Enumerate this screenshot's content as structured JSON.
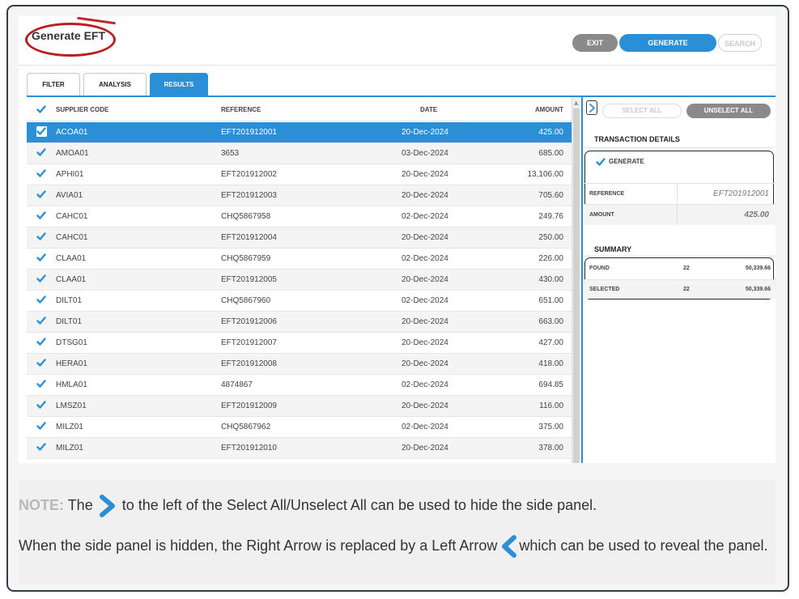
{
  "header": {
    "title": "Generate EFT",
    "exit_label": "EXIT",
    "generate_label": "GENERATE",
    "search_label": "SEARCH"
  },
  "tabs": [
    {
      "label": "FILTER"
    },
    {
      "label": "ANALYSIS"
    },
    {
      "label": "RESULTS"
    }
  ],
  "table": {
    "columns": {
      "code": "SUPPLIER CODE",
      "reference": "REFERENCE",
      "date": "DATE",
      "amount": "AMOUNT"
    },
    "rows": [
      {
        "code": "ACOA01",
        "reference": "EFT201912001",
        "date": "20-Dec-2024",
        "amount": "425.00"
      },
      {
        "code": "AMOA01",
        "reference": "3653",
        "date": "03-Dec-2024",
        "amount": "685.00"
      },
      {
        "code": "APHI01",
        "reference": "EFT201912002",
        "date": "20-Dec-2024",
        "amount": "13,106.00"
      },
      {
        "code": "AVIA01",
        "reference": "EFT201912003",
        "date": "20-Dec-2024",
        "amount": "705.60"
      },
      {
        "code": "CAHC01",
        "reference": "CHQ5867958",
        "date": "02-Dec-2024",
        "amount": "249.76"
      },
      {
        "code": "CAHC01",
        "reference": "EFT201912004",
        "date": "20-Dec-2024",
        "amount": "250.00"
      },
      {
        "code": "CLAA01",
        "reference": "CHQ5867959",
        "date": "02-Dec-2024",
        "amount": "226.00"
      },
      {
        "code": "CLAA01",
        "reference": "EFT201912005",
        "date": "20-Dec-2024",
        "amount": "430.00"
      },
      {
        "code": "DILT01",
        "reference": "CHQ5867960",
        "date": "02-Dec-2024",
        "amount": "651.00"
      },
      {
        "code": "DILT01",
        "reference": "EFT201912006",
        "date": "20-Dec-2024",
        "amount": "663.00"
      },
      {
        "code": "DTSG01",
        "reference": "EFT201912007",
        "date": "20-Dec-2024",
        "amount": "427.00"
      },
      {
        "code": "HERA01",
        "reference": "EFT201912008",
        "date": "20-Dec-2024",
        "amount": "418.00"
      },
      {
        "code": "HMLA01",
        "reference": "4874867",
        "date": "02-Dec-2024",
        "amount": "694.85"
      },
      {
        "code": "LMSZ01",
        "reference": "EFT201912009",
        "date": "20-Dec-2024",
        "amount": "116.00"
      },
      {
        "code": "MILZ01",
        "reference": "CHQ5867962",
        "date": "02-Dec-2024",
        "amount": "375.00"
      },
      {
        "code": "MILZ01",
        "reference": "EFT201912010",
        "date": "20-Dec-2024",
        "amount": "378.00"
      }
    ]
  },
  "side": {
    "select_all": "SELECT ALL",
    "unselect_all": "UNSELECT ALL",
    "transaction_title": "TRANSACTION DETAILS",
    "generate_label": "GENERATE",
    "reference_label": "REFERENCE",
    "reference_value": "EFT201912001",
    "amount_label": "AMOUNT",
    "amount_value": "425.00",
    "summary_title": "SUMMARY",
    "found_label": "FOUND",
    "found_count": "22",
    "found_total": "50,339.66",
    "selected_label": "SELECTED",
    "selected_count": "22",
    "selected_total": "50,339.66"
  },
  "note": {
    "label": "NOTE:",
    "line1_a": "The",
    "line1_b": "to the left of the Select All/Unselect All can be used to hide the side panel.",
    "line2_a": "When the side panel is hidden, the Right Arrow is replaced by a Left Arrow",
    "line2_b": "which can be used to reveal the panel."
  },
  "colors": {
    "accent": "#2a8fd6",
    "highlight": "#b81e24"
  }
}
